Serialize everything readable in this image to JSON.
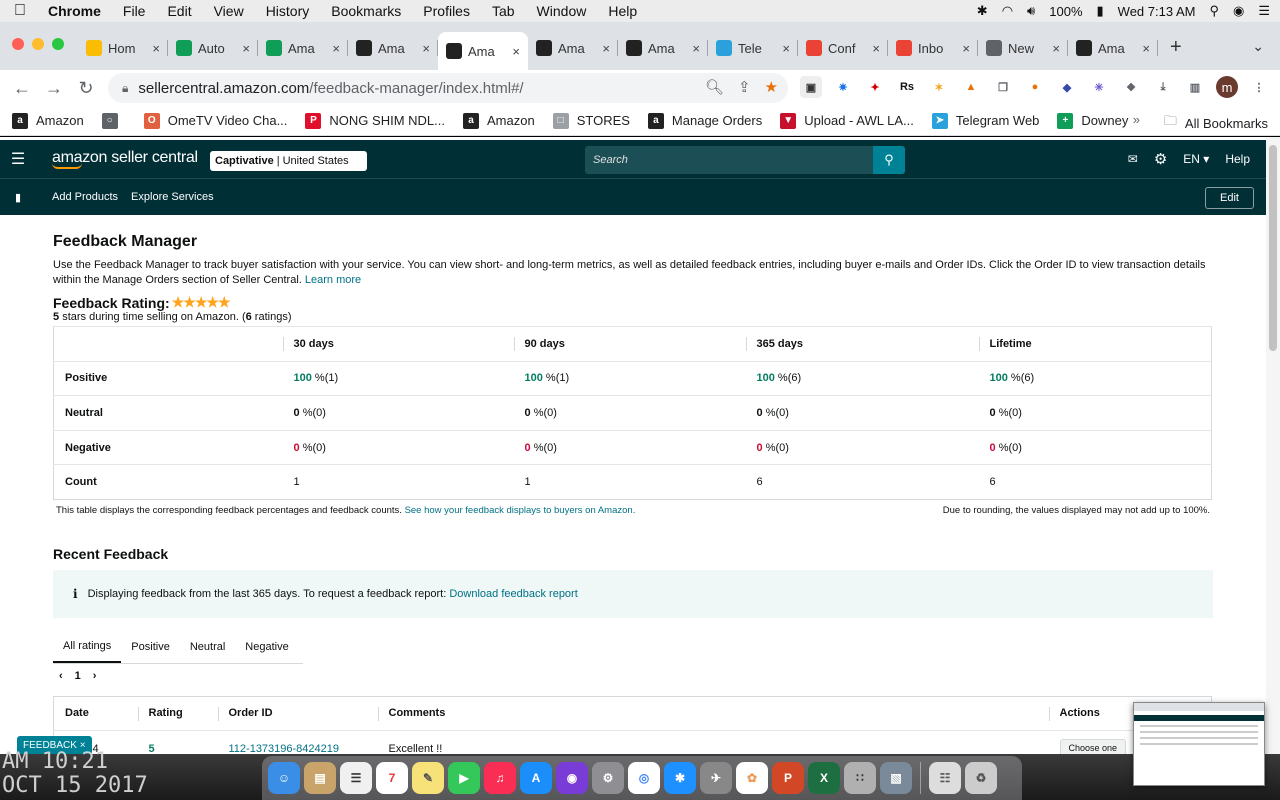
{
  "menubar": {
    "app": "Chrome",
    "items": [
      "File",
      "Edit",
      "View",
      "History",
      "Bookmarks",
      "Profiles",
      "Tab",
      "Window",
      "Help"
    ],
    "battery": "100%",
    "clock": "Wed 7:13 AM"
  },
  "tabs": [
    {
      "title": "Hom",
      "favicon_color": "#fbbc04"
    },
    {
      "title": "Auto",
      "favicon_color": "#0f9d58"
    },
    {
      "title": "Ama",
      "favicon_color": "#0f9d58"
    },
    {
      "title": "Ama",
      "favicon_color": "#222222"
    },
    {
      "title": "Ama",
      "favicon_color": "#222222"
    },
    {
      "title": "Ama",
      "favicon_color": "#222222"
    },
    {
      "title": "Ama",
      "favicon_color": "#222222"
    },
    {
      "title": "Tele",
      "favicon_color": "#2aa1da"
    },
    {
      "title": "Conf",
      "favicon_color": "#ea4335"
    },
    {
      "title": "Inbo",
      "favicon_color": "#ea4335"
    },
    {
      "title": "New",
      "favicon_color": "#5f6368"
    },
    {
      "title": "Ama",
      "favicon_color": "#222222"
    }
  ],
  "address": {
    "host": "sellercentral.amazon.com",
    "path": "/feedback-manager/index.html#/"
  },
  "bookmarks": [
    {
      "label": "Amazon",
      "color": "#222222",
      "glyph": "a"
    },
    {
      "label": "",
      "color": "#5f6368",
      "glyph": "○"
    },
    {
      "label": "OmeTV Video Cha...",
      "color": "#e06040",
      "glyph": "O"
    },
    {
      "label": "NONG SHIM NDL...",
      "color": "#e0102d",
      "glyph": "P"
    },
    {
      "label": "Amazon",
      "color": "#222222",
      "glyph": "a"
    },
    {
      "label": "STORES",
      "color": "#9aa0a6",
      "glyph": "□"
    },
    {
      "label": "Manage Orders",
      "color": "#222222",
      "glyph": "a"
    },
    {
      "label": "Upload - AWL LA...",
      "color": "#c5112b",
      "glyph": "▼"
    },
    {
      "label": "Telegram Web",
      "color": "#2aa1da",
      "glyph": "➤"
    },
    {
      "label": "Downey",
      "color": "#0f9d58",
      "glyph": "+"
    }
  ],
  "bookmarks_all": "All Bookmarks",
  "seller": {
    "logo": "amazon seller central",
    "account_name": "Captivative",
    "account_region": "| United States",
    "search_placeholder": "Search",
    "lang": "EN",
    "help": "Help",
    "nav_add": "Add Products",
    "nav_explore": "Explore Services",
    "edit": "Edit"
  },
  "page": {
    "title": "Feedback Manager",
    "description": "Use the Feedback Manager to track buyer satisfaction with your service. You can view short- and long-term metrics, as well as detailed feedback entries, including buyer e-mails and Order IDs. Click the Order ID to view transaction details within the Manage Orders section of Seller Central.",
    "learn_more": "Learn more",
    "rating_label": "Feedback Rating:",
    "rating_stars": 5,
    "rating_value": "5",
    "rating_mid": "stars during time selling on Amazon. (",
    "rating_count": "6",
    "rating_end": "ratings)"
  },
  "metrics": {
    "periods": [
      "30 days",
      "90 days",
      "365 days",
      "Lifetime"
    ],
    "rows": [
      {
        "label": "Positive",
        "cells": [
          {
            "v": "100",
            "c": "(1)"
          },
          {
            "v": "100",
            "c": "(1)"
          },
          {
            "v": "100",
            "c": "(6)"
          },
          {
            "v": "100",
            "c": "(6)"
          }
        ]
      },
      {
        "label": "Neutral",
        "cells": [
          {
            "v": "0",
            "c": "(0)"
          },
          {
            "v": "0",
            "c": "(0)"
          },
          {
            "v": "0",
            "c": "(0)"
          },
          {
            "v": "0",
            "c": "(0)"
          }
        ]
      },
      {
        "label": "Negative",
        "cells": [
          {
            "v": "0",
            "c": "(0)"
          },
          {
            "v": "0",
            "c": "(0)"
          },
          {
            "v": "0",
            "c": "(0)"
          },
          {
            "v": "0",
            "c": "(0)"
          }
        ]
      }
    ],
    "pct": "%",
    "count_label": "Count",
    "counts": [
      "1",
      "1",
      "6",
      "6"
    ],
    "note_left": "This table displays the corresponding feedback percentages and feedback counts.",
    "note_link": "See how your feedback displays to buyers on Amazon.",
    "note_right": "Due to rounding, the values displayed may not add up to 100%."
  },
  "recent": {
    "title": "Recent Feedback",
    "info_text": "Displaying feedback from the last 365 days. To request a feedback report:",
    "info_link": "Download feedback report",
    "tabs": [
      "All ratings",
      "Positive",
      "Neutral",
      "Negative"
    ],
    "page": "1",
    "columns": [
      "Date",
      "Rating",
      "Order ID",
      "Comments",
      "Actions"
    ],
    "rows": [
      {
        "date": "4/2024",
        "rating": "5",
        "order_id": "112-1373196-8424219",
        "comment": "Excellent !!",
        "action": "Choose one"
      }
    ]
  },
  "feedback_tab": "FEEDBACK",
  "wall_clock": [
    "AM 10:21",
    "OCT 15 2017"
  ],
  "colors": {
    "header": "#002f36",
    "link": "#007185",
    "positive": "#067d62",
    "negative": "#cc0c39",
    "star": "#ffa41c"
  }
}
